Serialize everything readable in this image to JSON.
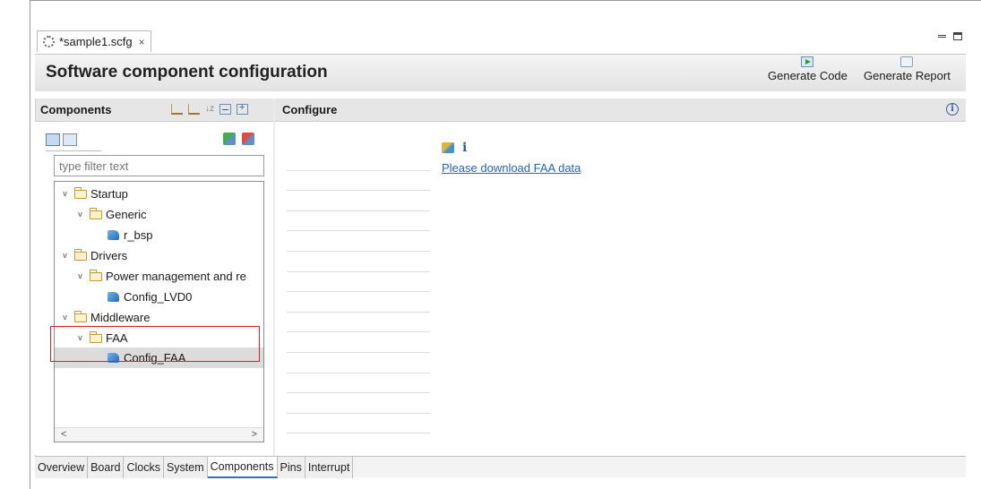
{
  "editor_tab": {
    "title": "*sample1.scfg",
    "close": "×"
  },
  "header": {
    "title": "Software component configuration",
    "generate_code": "Generate Code",
    "generate_report": "Generate Report"
  },
  "components_panel": {
    "title": "Components",
    "filter_placeholder": "type filter text",
    "tree": [
      {
        "label": "Startup",
        "type": "folder",
        "level": 0,
        "expanded": true
      },
      {
        "label": "Generic",
        "type": "folder",
        "level": 1,
        "expanded": true
      },
      {
        "label": "r_bsp",
        "type": "component",
        "level": 2
      },
      {
        "label": "Drivers",
        "type": "folder",
        "level": 0,
        "expanded": true
      },
      {
        "label": "Power management and re",
        "type": "folder",
        "level": 1,
        "expanded": true
      },
      {
        "label": "Config_LVD0",
        "type": "component",
        "level": 2
      },
      {
        "label": "Middleware",
        "type": "folder",
        "level": 0,
        "expanded": true
      },
      {
        "label": "FAA",
        "type": "folder",
        "level": 1,
        "expanded": true
      },
      {
        "label": "Config_FAA",
        "type": "component",
        "level": 2,
        "selected": true
      }
    ]
  },
  "configure_panel": {
    "title": "Configure",
    "link": "Please download FAA data"
  },
  "bottom_tabs": [
    {
      "label": "Overview"
    },
    {
      "label": "Board"
    },
    {
      "label": "Clocks"
    },
    {
      "label": "System"
    },
    {
      "label": "Components",
      "active": true
    },
    {
      "label": "Pins"
    },
    {
      "label": "Interrupt"
    }
  ],
  "colors": {
    "highlight": "#d7222e",
    "link": "#2266bf",
    "active_tab": "#2f72c3"
  }
}
